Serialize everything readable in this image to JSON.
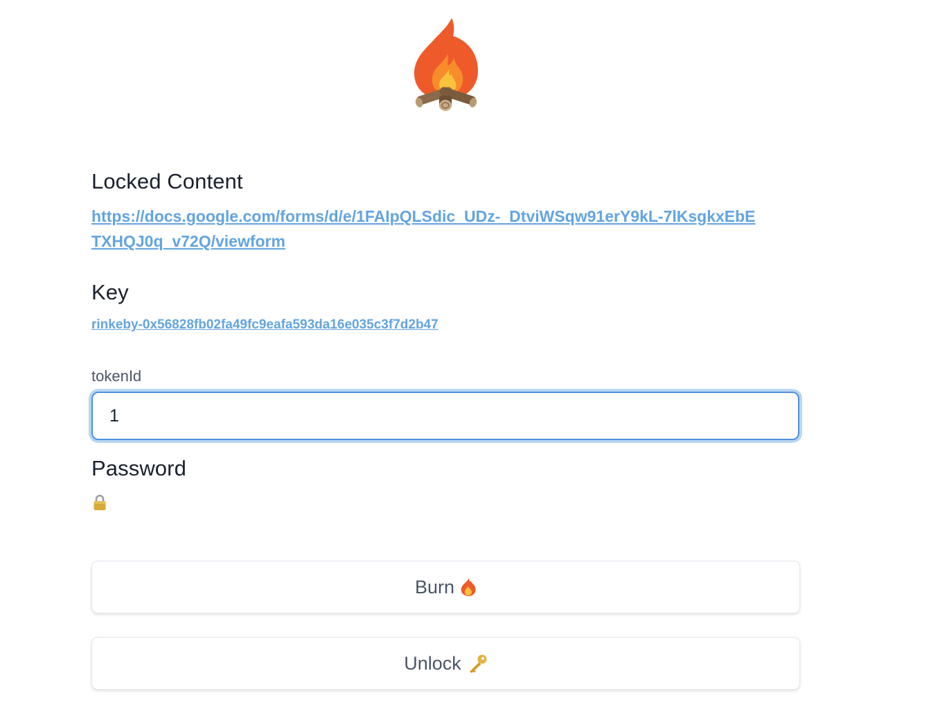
{
  "logo": {
    "icon": "campfire-icon"
  },
  "locked_content": {
    "heading": "Locked Content",
    "url": "https://docs.google.com/forms/d/e/1FAIpQLSdic_UDz-_DtviWSqw91erY9kL-7lKsgkxEbETXHQJ0q_v72Q/viewform"
  },
  "key": {
    "heading": "Key",
    "value": "rinkeby-0x56828fb02fa49fc9eafa593da16e035c3f7d2b47"
  },
  "token": {
    "label": "tokenId",
    "value": "1"
  },
  "password": {
    "heading": "Password",
    "icon": "lock-icon"
  },
  "buttons": {
    "burn": {
      "label": "Burn",
      "icon": "fire-icon"
    },
    "unlock": {
      "label": "Unlock",
      "icon": "key-icon"
    }
  },
  "colors": {
    "link": "#63a4e0",
    "focus_ring": "#4f8fe0",
    "flame_outer": "#ef5a2b",
    "flame_inner": "#f9c23c"
  }
}
